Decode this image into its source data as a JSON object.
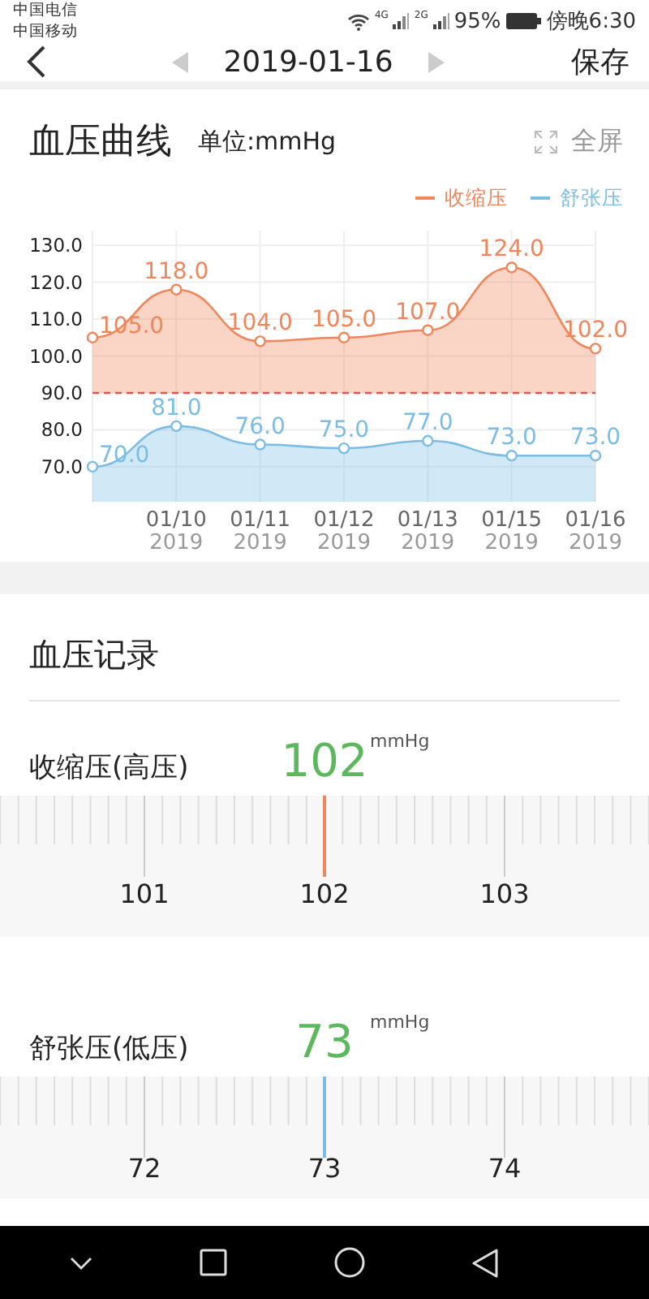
{
  "status_bar": {
    "carriers": [
      "中国电信",
      "中国移动"
    ],
    "network_labels": [
      "4G",
      "2G"
    ],
    "battery": "95%",
    "time": "傍晚6:30"
  },
  "header": {
    "date": "2019-01-16",
    "save": "保存"
  },
  "chart_card": {
    "title": "血压曲线",
    "unit": "单位:mmHg",
    "fullscreen": "全屏",
    "chart_data": {
      "type": "area",
      "categories": [
        null,
        "01/10\n2019",
        "01/11\n2019",
        "01/12\n2019",
        "01/13\n2019",
        "01/15\n2019",
        "01/16\n2019"
      ],
      "yticks": [
        {
          "value": 70,
          "label": "70.0"
        },
        {
          "value": 80,
          "label": "80.0"
        },
        {
          "value": 90,
          "label": "90.0"
        },
        {
          "value": 100,
          "label": "100.0"
        },
        {
          "value": 110,
          "label": "110.0"
        },
        {
          "value": 120,
          "label": "120.0"
        },
        {
          "value": 130,
          "label": "130.0"
        }
      ],
      "ylim": [
        60.5,
        134
      ],
      "series": [
        {
          "name": "收缩压",
          "color": "#f0865a",
          "values": [
            105,
            118,
            104,
            105,
            107,
            124,
            102
          ],
          "value_labels": [
            "105.0",
            "118.0",
            "104.0",
            "105.0",
            "107.0",
            "124.0",
            "102.0"
          ]
        },
        {
          "name": "舒张压",
          "color": "#7cbde6",
          "values": [
            70,
            81,
            76,
            75,
            77,
            73,
            73
          ],
          "value_labels": [
            "70.0",
            "81.0",
            "76.0",
            "75.0",
            "77.0",
            "73.0",
            "73.0"
          ]
        }
      ],
      "grid": true,
      "ref_lines": [
        {
          "axis": "y",
          "value": 90,
          "color": "#e0574a"
        }
      ]
    }
  },
  "records": {
    "title": "血压记录",
    "items": [
      {
        "label": "收缩压(高压)",
        "value": "102",
        "unit": "mmHg",
        "color": "#f0865a",
        "level": 0.5,
        "scale": [
          "101",
          "102",
          "103"
        ]
      },
      {
        "label": "舒张压(低压)",
        "value": "73",
        "unit": "mmHg",
        "color": "#7cbde6",
        "level": 0.5,
        "scale": [
          "72",
          "73",
          "74"
        ]
      }
    ]
  }
}
